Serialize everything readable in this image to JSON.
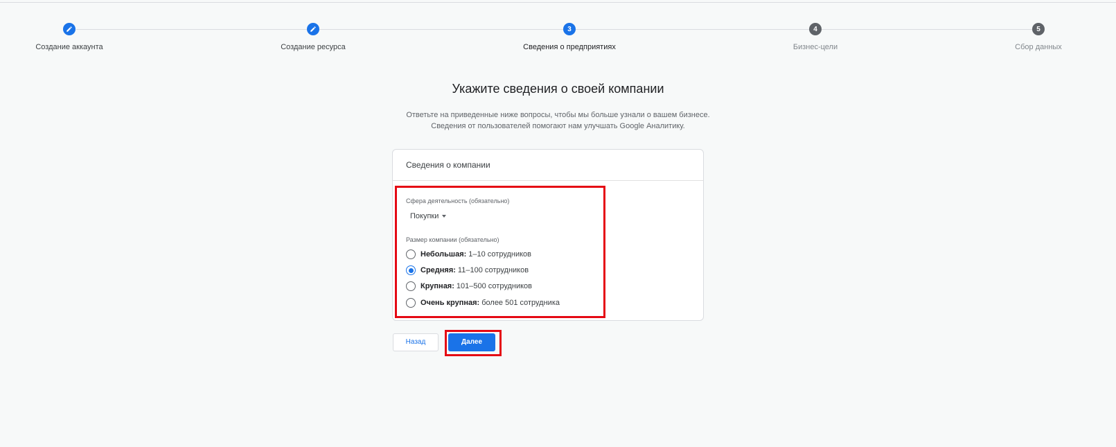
{
  "stepper": {
    "steps": [
      {
        "number": "",
        "label": "Создание аккаунта",
        "state": "done",
        "icon": "pencil-icon"
      },
      {
        "number": "",
        "label": "Создание ресурса",
        "state": "done",
        "icon": "pencil-icon"
      },
      {
        "number": "3",
        "label": "Сведения о предприятиях",
        "state": "active"
      },
      {
        "number": "4",
        "label": "Бизнес-цели",
        "state": "todo"
      },
      {
        "number": "5",
        "label": "Сбор данных",
        "state": "todo"
      }
    ]
  },
  "page": {
    "title": "Укажите сведения о своей компании",
    "description_line1": "Ответьте на приведенные ниже вопросы, чтобы мы больше узнали о вашем бизнесе.",
    "description_line2": "Сведения от пользователей помогают нам улучшать Google Аналитику."
  },
  "card": {
    "header": "Сведения о компании",
    "industry": {
      "label": "Сфера деятельность (обязательно)",
      "value": "Покупки"
    },
    "size": {
      "label": "Размер компании (обязательно)",
      "options": [
        {
          "name": "Небольшая:",
          "detail": "1–10 сотрудников",
          "checked": false
        },
        {
          "name": "Средняя:",
          "detail": "11–100 сотрудников",
          "checked": true
        },
        {
          "name": "Крупная:",
          "detail": "101–500 сотрудников",
          "checked": false
        },
        {
          "name": "Очень крупная:",
          "detail": "более 501 сотрудника",
          "checked": false
        }
      ]
    }
  },
  "actions": {
    "back_label": "Назад",
    "next_label": "Далее"
  },
  "colors": {
    "accent": "#1a73e8",
    "highlight": "#e50914",
    "inactive_step": "#5f6368"
  }
}
